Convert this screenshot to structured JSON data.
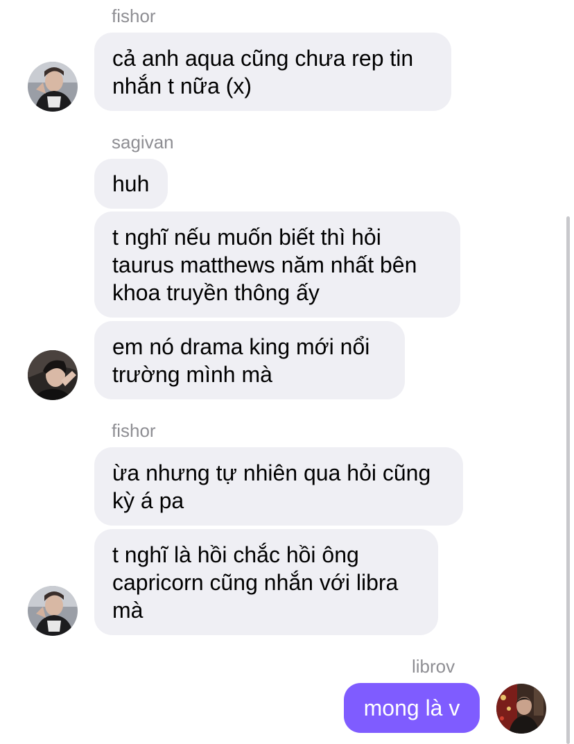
{
  "messages": {
    "group1": {
      "sender": "fishor",
      "m1": "cả anh aqua cũng chưa rep tin\nnhắn t nữa (x)"
    },
    "group2": {
      "sender": "sagivan",
      "m1": "huh",
      "m2": "t nghĩ nếu muốn biết thì hỏi\ntaurus matthews năm nhất bên\nkhoa truyền thông ấy",
      "m3": "em nó drama king mới nổi\ntrường mình mà"
    },
    "group3": {
      "sender": "fishor",
      "m1": "ừa nhưng tự nhiên qua hỏi cũng\nkỳ á pa",
      "m2": "t nghĩ là hồi chắc hồi ông\ncapricorn cũng nhắn với libra\nmà"
    },
    "group4": {
      "sender": "librov",
      "m1": "mong là v"
    }
  },
  "colors": {
    "incoming_bubble": "#efeff4",
    "outgoing_bubble": "#7f5cff",
    "sender_text": "#8e8e93"
  }
}
